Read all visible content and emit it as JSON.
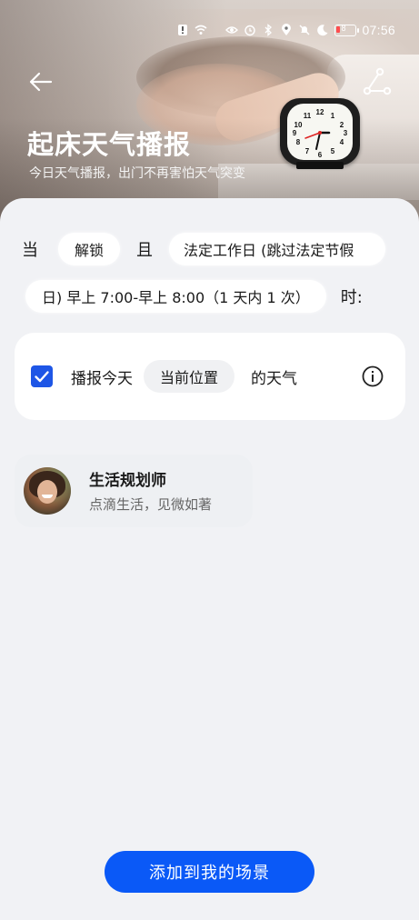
{
  "status_bar": {
    "time": "07:56",
    "battery_level": "8",
    "icons": [
      "sim-alert-icon",
      "wifi-icon",
      "eye-comfort-icon",
      "alarm-icon",
      "bluetooth-icon",
      "location-icon",
      "mute-icon",
      "moon-icon",
      "battery-icon"
    ]
  },
  "header": {
    "title": "起床天气播报",
    "subtitle": "今日天气播报，出门不再害怕天气突变",
    "back_icon": "arrow-left-icon",
    "flow_icon": "flow-share-icon"
  },
  "condition": {
    "when_word": "当",
    "trigger_chip": "解锁",
    "and_word": "且",
    "schedule_chip_line1": "法定工作日 (跳过法定节假",
    "schedule_chip_line2": "日) 早上 7:00-早上 8:00（1 天内 1 次）",
    "time_suffix": "时:"
  },
  "action": {
    "checked": true,
    "text_before": "播报今天",
    "location_chip": "当前位置",
    "text_after": "的天气",
    "info_icon": "info-icon"
  },
  "author": {
    "name": "生活规划师",
    "description": "点滴生活，见微如著"
  },
  "footer": {
    "add_button": "添加到我的场景"
  },
  "colors": {
    "accent": "#0a59f7",
    "checkbox": "#1e56e6",
    "background": "#f1f2f5"
  }
}
